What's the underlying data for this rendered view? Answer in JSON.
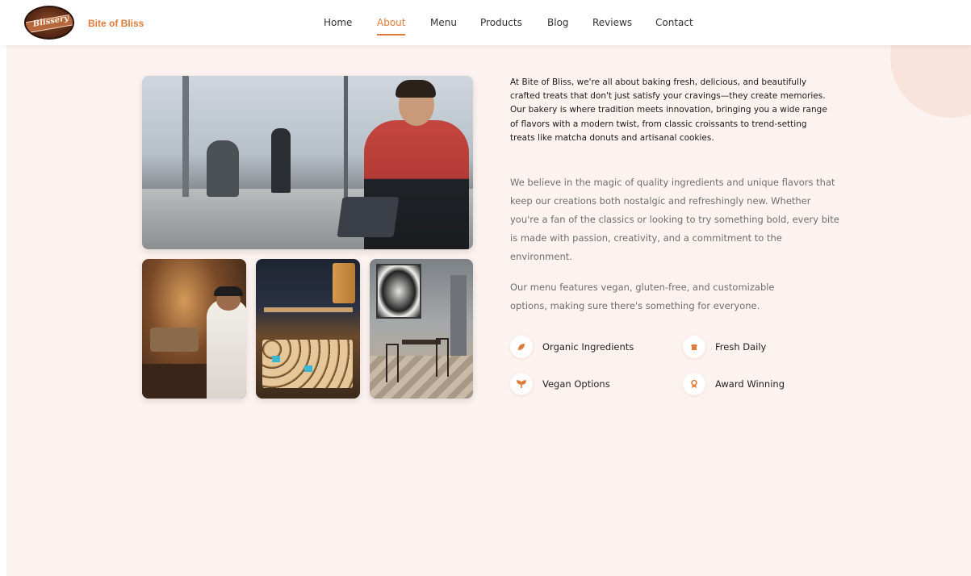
{
  "brand": {
    "name": "Bite of Bliss",
    "logo_text": "Blissery"
  },
  "nav": {
    "items": [
      {
        "label": "Home"
      },
      {
        "label": "About"
      },
      {
        "label": "Menu"
      },
      {
        "label": "Products"
      },
      {
        "label": "Blog"
      },
      {
        "label": "Reviews"
      },
      {
        "label": "Contact"
      }
    ],
    "active": "About"
  },
  "about": {
    "intro": "At Bite of Bliss, we're all about baking fresh, delicious, and beautifully crafted treats that don't just satisfy your cravings—they create memories. Our bakery is where tradition meets innovation, bringing you a wide range of flavors with a modern twist, from classic croissants to trend-setting treats like matcha donuts and artisanal cookies.",
    "paragraph_1": "We believe in the magic of quality ingredients and unique flavors that keep our creations both nostalgic and refreshingly new. Whether you're a fan of the classics or looking to try something bold, every bite is made with passion, creativity, and a commitment to the environment.",
    "paragraph_2": "Our menu features vegan, gluten-free, and customizable options, making sure there's something for everyone.",
    "features": [
      {
        "label": "Organic Ingredients",
        "icon": "leaf-icon"
      },
      {
        "label": "Fresh Daily",
        "icon": "bread-icon"
      },
      {
        "label": "Vegan Options",
        "icon": "seedling-icon"
      },
      {
        "label": "Award Winning",
        "icon": "award-icon"
      }
    ]
  },
  "colors": {
    "accent": "#e07b39",
    "page_background": "#fcf2ef",
    "header_background": "#ffffff",
    "body_text": "#6e6e6e"
  }
}
